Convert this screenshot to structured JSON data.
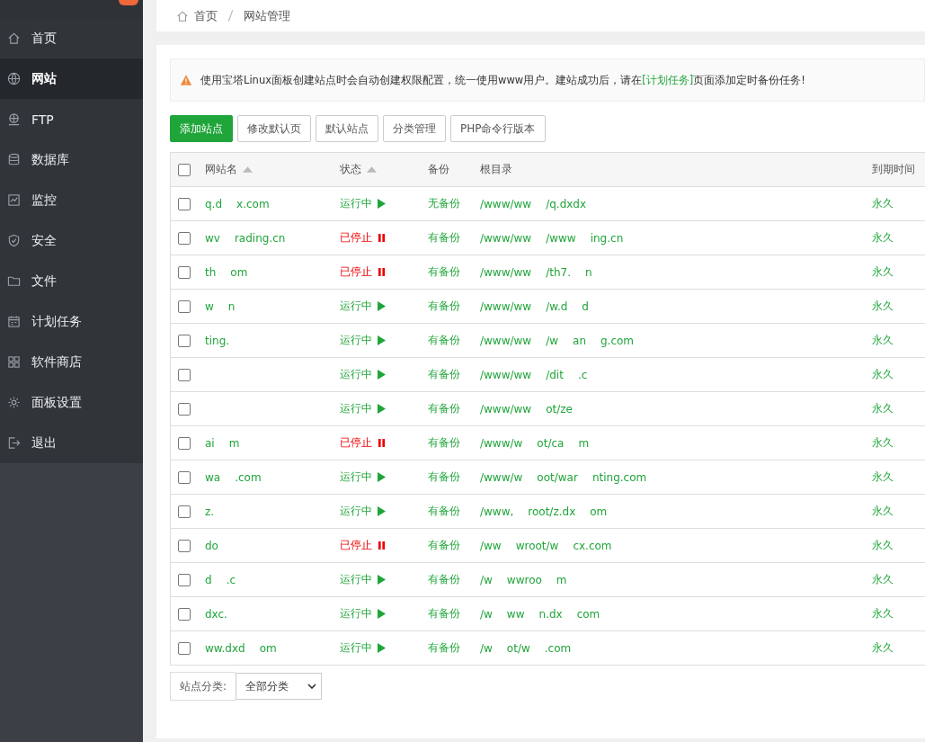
{
  "sidebar": {
    "items": [
      {
        "label": "首页",
        "selected": false
      },
      {
        "label": "网站",
        "selected": true
      },
      {
        "label": "FTP",
        "selected": false
      },
      {
        "label": "数据库",
        "selected": false
      },
      {
        "label": "监控",
        "selected": false
      },
      {
        "label": "安全",
        "selected": false
      },
      {
        "label": "文件",
        "selected": false
      },
      {
        "label": "计划任务",
        "selected": false
      },
      {
        "label": "软件商店",
        "selected": false
      },
      {
        "label": "面板设置",
        "selected": false
      },
      {
        "label": "退出",
        "selected": false
      }
    ]
  },
  "breadcrumb": [
    "首页",
    "网站管理"
  ],
  "alert": {
    "before": "使用宝塔Linux面板创建站点时会自动创建权限配置，统一使用www用户。建站成功后，请在",
    "link": "[计划任务]",
    "after": "页面添加定时备份任务!"
  },
  "toolbar": [
    {
      "label": "添加站点",
      "kind": "primary"
    },
    {
      "label": "修改默认页",
      "kind": "default"
    },
    {
      "label": "默认站点",
      "kind": "default"
    },
    {
      "label": "分类管理",
      "kind": "default"
    },
    {
      "label": "PHP命令行版本",
      "kind": "default"
    }
  ],
  "table": {
    "header_checked": false,
    "columns": [
      {
        "label": "网站名",
        "sortable": true
      },
      {
        "label": "状态",
        "sortable": true
      },
      {
        "label": "备份",
        "sortable": false
      },
      {
        "label": "根目录",
        "sortable": false
      },
      {
        "label": "到期时间",
        "sortable": false
      }
    ],
    "rows": [
      {
        "checked": false,
        "name": [
          "q.d",
          "x.com"
        ],
        "status": "运行中",
        "kind": "running",
        "backup": "无备份",
        "path": [
          "/www/ww",
          "/q.dxdx"
        ],
        "expiry": "永久"
      },
      {
        "checked": false,
        "name": [
          "wv",
          "rading.cn"
        ],
        "status": "已停止",
        "kind": "stopped",
        "backup": "有备份",
        "path": [
          "/www/ww",
          "/www",
          "ing.cn"
        ],
        "expiry": "永久"
      },
      {
        "checked": false,
        "name": [
          "th",
          "om"
        ],
        "status": "已停止",
        "kind": "stopped",
        "backup": "有备份",
        "path": [
          "/www/ww",
          "/th7.",
          "n"
        ],
        "expiry": "永久"
      },
      {
        "checked": false,
        "name": [
          "w",
          "n"
        ],
        "status": "运行中",
        "kind": "running",
        "backup": "有备份",
        "path": [
          "/www/ww",
          "/w.d",
          "d"
        ],
        "expiry": "永久"
      },
      {
        "checked": false,
        "name": [
          "ting."
        ],
        "status": "运行中",
        "kind": "running",
        "backup": "有备份",
        "path": [
          "/www/ww",
          "/w",
          "an",
          "g.com"
        ],
        "expiry": "永久"
      },
      {
        "checked": false,
        "name": [],
        "status": "运行中",
        "kind": "running",
        "backup": "有备份",
        "path": [
          "/www/ww",
          "/dit",
          ".c"
        ],
        "expiry": "永久"
      },
      {
        "checked": false,
        "name": [],
        "status": "运行中",
        "kind": "running",
        "backup": "有备份",
        "path": [
          "/www/ww",
          "ot/ze"
        ],
        "expiry": "永久"
      },
      {
        "checked": false,
        "name": [
          "ai",
          "m"
        ],
        "status": "已停止",
        "kind": "stopped",
        "backup": "有备份",
        "path": [
          "/www/w",
          "ot/ca",
          "m"
        ],
        "expiry": "永久"
      },
      {
        "checked": false,
        "name": [
          "wa",
          ".com"
        ],
        "status": "运行中",
        "kind": "running",
        "backup": "有备份",
        "path": [
          "/www/w",
          "oot/war",
          "nting.com"
        ],
        "expiry": "永久"
      },
      {
        "checked": false,
        "name": [
          "z."
        ],
        "status": "运行中",
        "kind": "running",
        "backup": "有备份",
        "path": [
          "/www,",
          "root/z.dx",
          "om"
        ],
        "expiry": "永久"
      },
      {
        "checked": false,
        "name": [
          "do"
        ],
        "status": "已停止",
        "kind": "stopped",
        "backup": "有备份",
        "path": [
          "/ww",
          "wroot/w",
          "cx.com"
        ],
        "expiry": "永久"
      },
      {
        "checked": false,
        "name": [
          "d",
          ".c"
        ],
        "status": "运行中",
        "kind": "running",
        "backup": "有备份",
        "path": [
          "/w",
          "wwroo",
          "m"
        ],
        "expiry": "永久"
      },
      {
        "checked": false,
        "name": [
          "dxc."
        ],
        "status": "运行中",
        "kind": "running",
        "backup": "有备份",
        "path": [
          "/w",
          "ww",
          "n.dx",
          "com"
        ],
        "expiry": "永久"
      },
      {
        "checked": false,
        "name": [
          "ww.dxd",
          "om"
        ],
        "status": "运行中",
        "kind": "running",
        "backup": "有备份",
        "path": [
          "/w",
          "ot/w",
          ".com"
        ],
        "expiry": "永久"
      }
    ]
  },
  "footer": {
    "label": "站点分类:",
    "select": "全部分类"
  }
}
